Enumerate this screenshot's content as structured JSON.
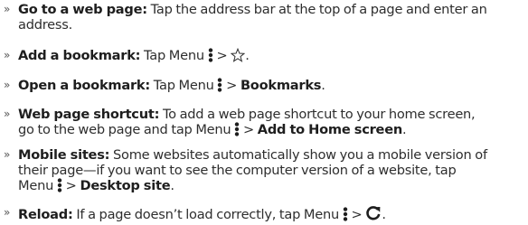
{
  "items": [
    {
      "term": "Go to a web page:",
      "line1": "Tap the address bar at the top of a page and enter an",
      "line2": "address."
    },
    {
      "term": "Add a bookmark:",
      "text": "Tap Menu",
      "sep": ">",
      "end": "."
    },
    {
      "term": "Open a bookmark:",
      "text": "Tap Menu",
      "sep": ">",
      "target": "Bookmarks",
      "end": "."
    },
    {
      "term": "Web page shortcut:",
      "line1": "To add a web page shortcut to your home screen,",
      "line2a": "go to the web page and tap Menu",
      "sep": ">",
      "target": "Add to Home screen",
      "end": "."
    },
    {
      "term": "Mobile sites:",
      "line1": "Some websites automatically show you a mobile version of",
      "line2": "their page—if you want to see the computer version of a website, tap",
      "line3a": "Menu",
      "sep": ">",
      "target": "Desktop site",
      "end": "."
    },
    {
      "term": "Reload:",
      "text": "If a page doesn’t load correctly, tap Menu",
      "sep": ">",
      "end": "."
    }
  ],
  "bullet": "»",
  "icons": [
    "menu-dots-icon",
    "star-outline-icon",
    "reload-icon"
  ]
}
